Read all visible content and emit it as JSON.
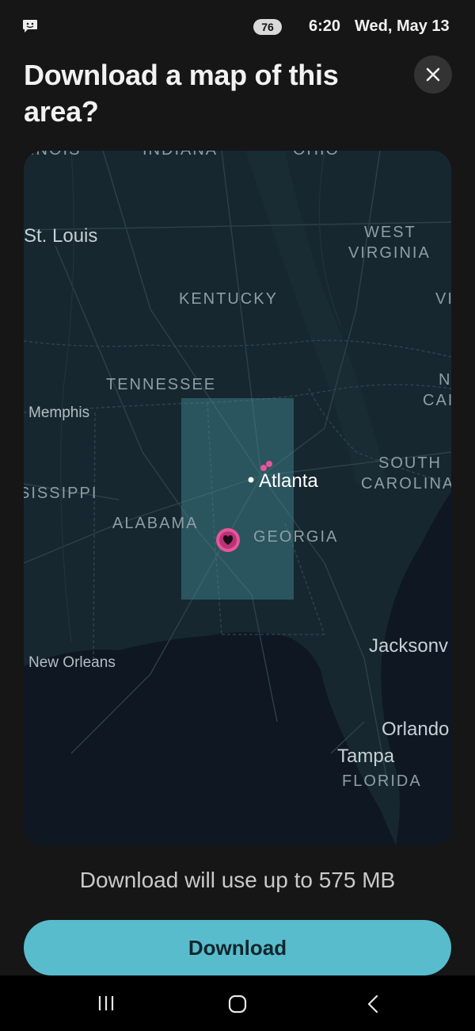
{
  "status_bar": {
    "battery": "76",
    "time": "6:20",
    "date": "Wed, May 13"
  },
  "dialog": {
    "title": "Download a map of this area?",
    "info": "Download will use up to 575 MB",
    "download_label": "Download"
  },
  "map": {
    "labels": {
      "illinois_partial": "INOIS",
      "indiana": "INDIANA",
      "ohio_partial": "OHIO",
      "st_louis": "St. Louis",
      "west_virginia_1": "WEST",
      "west_virginia_2": "VIRGINIA",
      "kentucky": "KENTUCKY",
      "virginia_partial": "VI",
      "tennessee": "TENNESSEE",
      "north_carolina_1": "N",
      "north_carolina_2": "CAI",
      "memphis": "Memphis",
      "atlanta": "Atlanta",
      "south_carolina_1": "SOUTH",
      "south_carolina_2": "CAROLINA",
      "mississippi_partial": "SISSIPPI",
      "alabama": "ALABAMA",
      "georgia": "GEORGIA",
      "jacksonville_partial": "Jacksonv",
      "new_orleans": "New Orleans",
      "orlando_partial": "Orlando",
      "tampa": "Tampa",
      "florida": "FLORIDA"
    }
  },
  "icons": {
    "notification": "chat-smiley-icon",
    "close": "close-icon",
    "marker": "location-marker-icon",
    "nav_recents": "recents-icon",
    "nav_home": "home-icon",
    "nav_back": "back-icon"
  },
  "colors": {
    "accent": "#58bccd",
    "marker": "#e8559b",
    "background": "#161616"
  }
}
